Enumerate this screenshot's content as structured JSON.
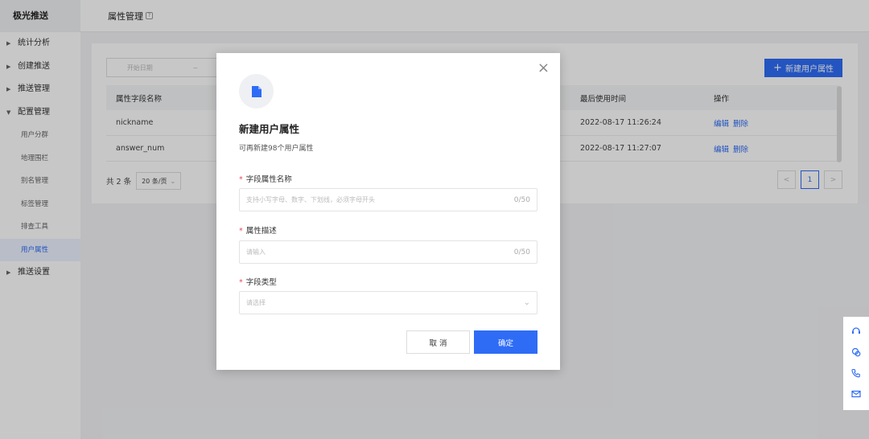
{
  "brand": "极光推送",
  "nav": {
    "groups": [
      {
        "label": "统计分析"
      },
      {
        "label": "创建推送"
      },
      {
        "label": "推送管理"
      },
      {
        "label": "配置管理"
      }
    ],
    "sub_items": [
      {
        "label": "用户分群"
      },
      {
        "label": "地理围栏"
      },
      {
        "label": "别名管理"
      },
      {
        "label": "标签管理"
      },
      {
        "label": "排查工具"
      },
      {
        "label": "用户属性"
      }
    ],
    "bottom_group": {
      "label": "推送设置"
    }
  },
  "header": {
    "title": "属性管理",
    "help": "?"
  },
  "toolbar": {
    "date_placeholder": "开始日期",
    "date_sep": "~",
    "new_button": "新建用户属性",
    "new_plus": "+"
  },
  "table": {
    "headers": {
      "name": "属性字段名称",
      "last_used": "最后使用时间",
      "action": "操作"
    },
    "rows": [
      {
        "name": "nickname",
        "last_used": "2022-08-17 11:26:24",
        "edit": "编辑",
        "delete": "删除"
      },
      {
        "name": "answer_num",
        "last_used": "2022-08-17 11:27:07",
        "edit": "编辑",
        "delete": "删除"
      }
    ]
  },
  "pagination": {
    "total": "共 2 条",
    "page_size": "20 条/页",
    "current_page": "1",
    "prev": "<",
    "next": ">"
  },
  "modal": {
    "title": "新建用户属性",
    "subtitle": "可再新建98个用户属性",
    "close": "×",
    "fields": [
      {
        "label": "字段属性名称",
        "placeholder": "支持小写字母、数字、下划线，必须字母开头",
        "counter": "0/50"
      },
      {
        "label": "属性描述",
        "placeholder": "请输入",
        "counter": "0/50"
      },
      {
        "label": "字段类型",
        "placeholder": "请选择"
      }
    ],
    "required_mark": "*",
    "cancel": "取 消",
    "confirm": "确定"
  },
  "colors": {
    "accent": "#2e6cf6",
    "required": "#e34d59"
  },
  "float_icons": [
    "headset-icon",
    "chat-icon",
    "phone-icon",
    "mail-icon"
  ]
}
